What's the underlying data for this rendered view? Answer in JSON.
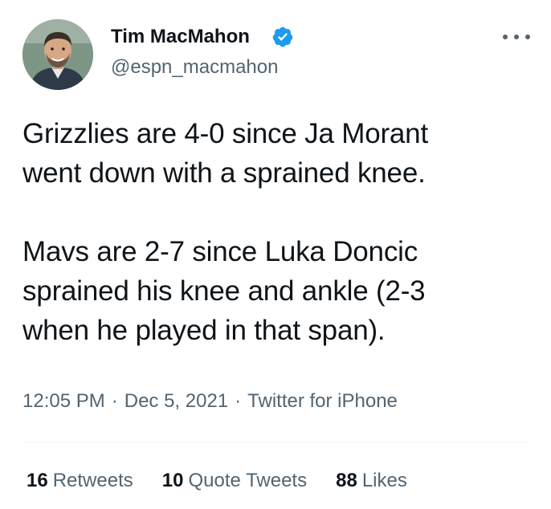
{
  "author": {
    "name": "Tim MacMahon",
    "handle": "@espn_macmahon",
    "verified": true
  },
  "tweet": {
    "paragraphs": [
      "Grizzlies are 4-0 since Ja Morant\nwent down with a sprained knee.",
      "Mavs are 2-7 since Luka Doncic\nsprained his knee and ankle (2-3\nwhen he played in that span)."
    ],
    "time": "12:05 PM",
    "date": "Dec 5, 2021",
    "source": "Twitter for iPhone",
    "separator": "·"
  },
  "stats": {
    "retweets_count": "16",
    "retweets_label": "Retweets",
    "quotes_count": "10",
    "quotes_label": "Quote Tweets",
    "likes_count": "88",
    "likes_label": "Likes"
  },
  "icons": {
    "verified": "verified-badge-icon",
    "more": "more-horizontal-icon"
  },
  "colors": {
    "verified": "#1d9bf0",
    "text": "#0f1419",
    "secondary": "#536471"
  }
}
